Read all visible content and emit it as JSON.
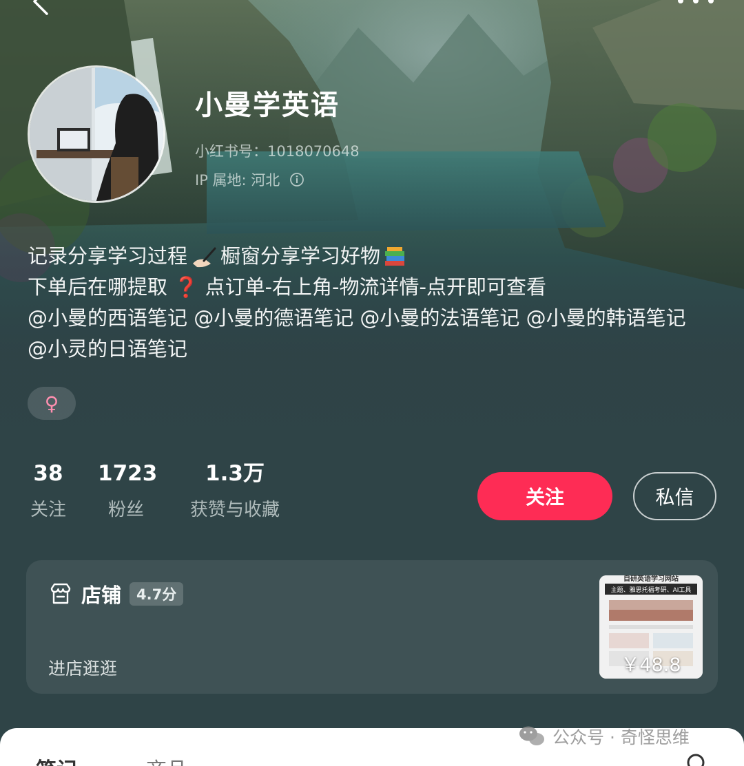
{
  "profile": {
    "name": "小曼学英语",
    "red_id": "小红书号：1018070648",
    "ip_location": "IP 属地: 河北",
    "gender_symbol": "♀"
  },
  "bio": {
    "line1_a": "记录分享学习过程",
    "line1_b": "橱窗分享学习好物",
    "line2_a": "下单后在哪提取",
    "line2_b": "点订单-右上角-物流详情-点开即可查看",
    "mentions": "@小曼的西语笔记 @小曼的德语笔记 @小曼的法语笔记 @小曼的韩语笔记 @小灵的日语笔记",
    "emoji_question": "❓"
  },
  "stats": {
    "following": {
      "value": "38",
      "label": "关注"
    },
    "fans": {
      "value": "1723",
      "label": "粉丝"
    },
    "likes": {
      "value": "1.3万",
      "label": "获赞与收藏"
    }
  },
  "actions": {
    "follow": "关注",
    "message": "私信"
  },
  "shop": {
    "title": "店铺",
    "score": "4.7分",
    "enter": "进店逛逛",
    "product_price": "￥48.8",
    "product_header": "自研英语学习网站",
    "product_subheader": "主题、雅思托福考研、AI工具"
  },
  "tabs": {
    "notes": "笔记",
    "goods": "商品"
  },
  "watermark": "公众号 · 奇怪思维",
  "colors": {
    "accent": "#fe2c55",
    "background": "#2f4447"
  }
}
